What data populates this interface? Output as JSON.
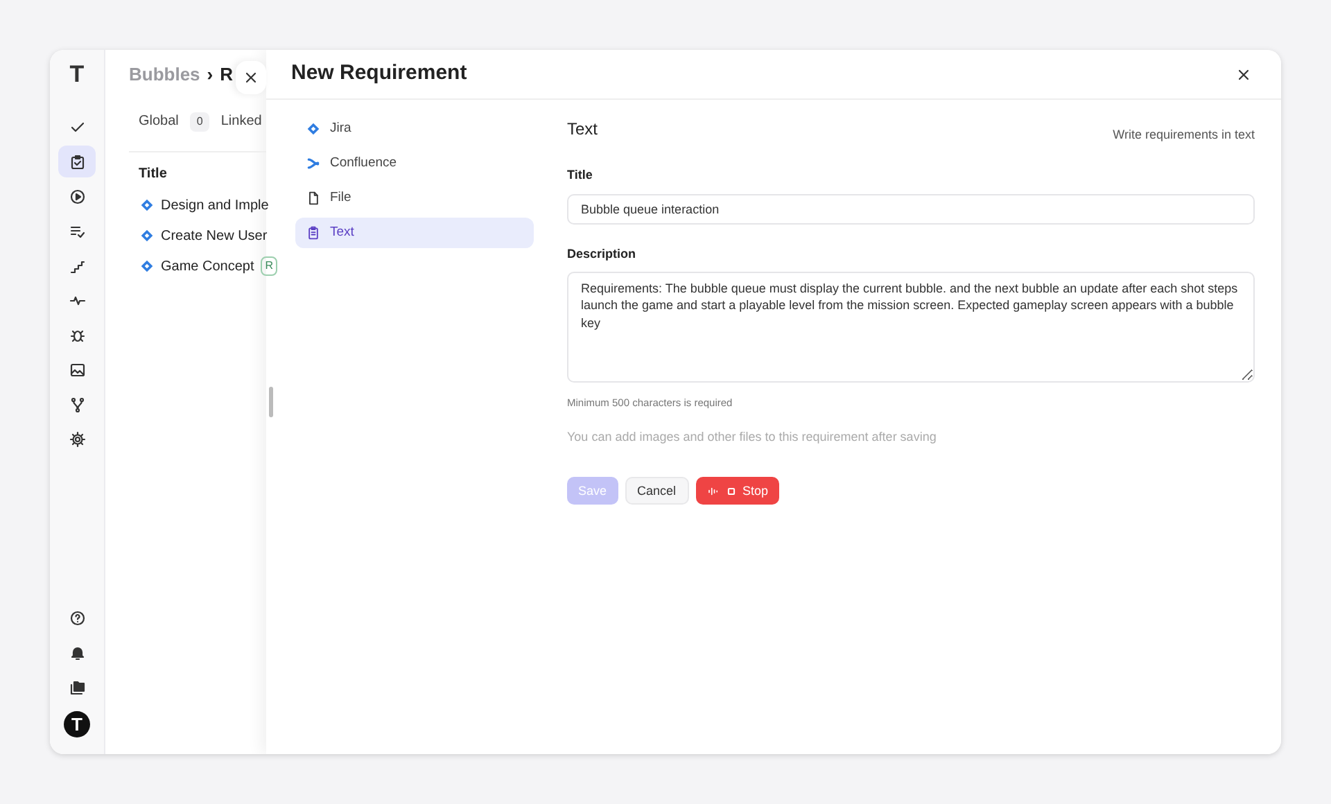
{
  "sidebar": {
    "logo": "T",
    "items": [
      {
        "kind": "check",
        "selected": false
      },
      {
        "kind": "clipboard",
        "selected": true
      },
      {
        "kind": "play",
        "selected": false
      },
      {
        "kind": "list",
        "selected": false
      },
      {
        "kind": "stairs",
        "selected": false
      },
      {
        "kind": "pulse",
        "selected": false
      },
      {
        "kind": "bug",
        "selected": false
      },
      {
        "kind": "image",
        "selected": false
      },
      {
        "kind": "branch",
        "selected": false
      },
      {
        "kind": "gear",
        "selected": false
      }
    ],
    "bottom_items": [
      {
        "kind": "help"
      },
      {
        "kind": "bell"
      },
      {
        "kind": "folders"
      }
    ],
    "avatar": "T"
  },
  "background_page": {
    "breadcrumb": [
      "Bubbles",
      "›",
      "R"
    ],
    "tabs": [
      {
        "label": "Global",
        "count": "0"
      },
      {
        "label": "Linked"
      }
    ],
    "table": {
      "columns": [
        "Title"
      ],
      "rows": [
        {
          "title": "Design and Imple"
        },
        {
          "title": "Create New User"
        },
        {
          "title": "Game Concept",
          "badge": "R"
        }
      ]
    }
  },
  "modal": {
    "title": "New Requirement",
    "sources": [
      {
        "kind": "jira",
        "label": "Jira",
        "selected": false
      },
      {
        "kind": "confluence",
        "label": "Confluence",
        "selected": false
      },
      {
        "kind": "file",
        "label": "File",
        "selected": false
      },
      {
        "kind": "text",
        "label": "Text",
        "selected": true
      }
    ],
    "heading": "Text",
    "hint": "Write requirements in text",
    "fields": [
      {
        "label": "Title",
        "kind": "input",
        "value": "Bubble queue interaction"
      },
      {
        "label": "Description",
        "kind": "textarea",
        "value": "Requirements: The bubble queue must display the current bubble. and the next bubble an update after each shot steps launch the game and start a playable level from the mission screen. Expected gameplay screen appears with a bubble key",
        "help": "Minimum 500 characters is required"
      }
    ],
    "note": "You can add images and other files to this requirement after saving",
    "buttons": [
      {
        "kind": "save",
        "label": "Save",
        "disabled": true
      },
      {
        "kind": "cancel",
        "label": "Cancel",
        "disabled": false
      },
      {
        "kind": "stop",
        "label": "Stop",
        "disabled": false
      }
    ]
  }
}
